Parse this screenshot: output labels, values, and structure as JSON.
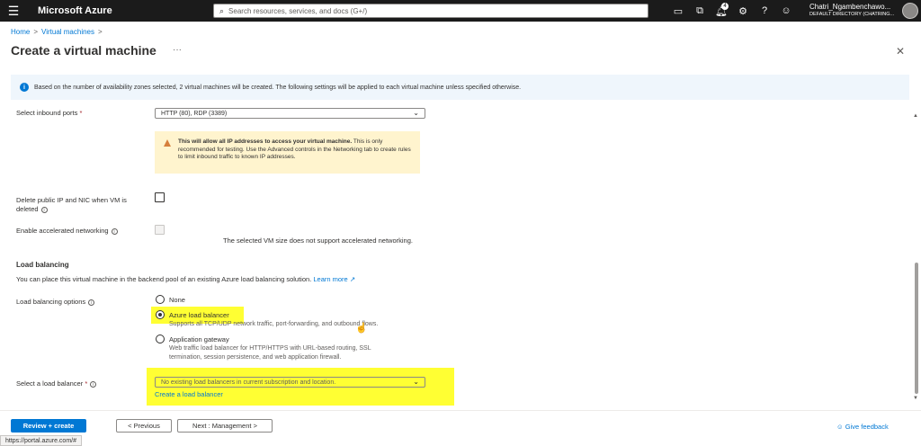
{
  "topbar": {
    "brand": "Microsoft Azure",
    "search_placeholder": "Search resources, services, and docs (G+/)",
    "notifications_count": "4",
    "user": "Chatri_Ngambenchawo...",
    "directory": "DEFAULT DIRECTORY (CHATRING..."
  },
  "breadcrumb": {
    "home": "Home",
    "vms": "Virtual machines"
  },
  "page": {
    "title": "Create a virtual machine",
    "more": "···"
  },
  "banner": {
    "text": "Based on the number of availability zones selected, 2 virtual machines will be created. The following settings will be applied to each virtual machine unless specified otherwise."
  },
  "inbound": {
    "label": "Select inbound ports",
    "value": "HTTP (80), RDP (3389)",
    "warning_bold": "This will allow all IP addresses to access your virtual machine.",
    "warning_rest": " This is only recommended for testing.  Use the Advanced controls in the Networking tab to create rules to limit inbound traffic to known IP addresses."
  },
  "delete_ip": {
    "label_line1": "Delete public IP and NIC when VM is",
    "label_line2": "deleted"
  },
  "accel": {
    "label": "Enable accelerated networking",
    "note": "The selected VM size does not support accelerated networking."
  },
  "lb": {
    "section_title": "Load balancing",
    "description": "You can place this virtual machine in the backend pool of an existing Azure load balancing solution.",
    "learn_more": "Learn more",
    "options_label": "Load balancing options",
    "options": [
      {
        "title": "None",
        "desc1": "",
        "desc2": "",
        "desc3": ""
      },
      {
        "title": "Azure load balancer",
        "desc1": "Supports all TCP/UDP network traffic, port-forwarding, and outbound flows.",
        "desc2": "",
        "desc3": ""
      },
      {
        "title": "Application gateway",
        "desc1": "Web traffic load balancer for HTTP/HTTPS with URL-based routing, SSL",
        "desc2": "termination, session persistence, and web application firewall.",
        "desc3": ""
      }
    ],
    "selected_option": "Azure load balancer",
    "select_label": "Select a load balancer",
    "select_value": "No existing load balancers in current subscription and location.",
    "create_link": "Create a load balancer"
  },
  "footer": {
    "review": "Review + create",
    "previous": "< Previous",
    "next": "Next : Management >",
    "feedback": "Give feedback"
  },
  "status_url": "https://portal.azure.com/#",
  "colors": {
    "accent": "#0078d4",
    "highlight": "#ffff33",
    "warning_bg": "#fff4ce",
    "banner_bg": "#eff6fc"
  }
}
